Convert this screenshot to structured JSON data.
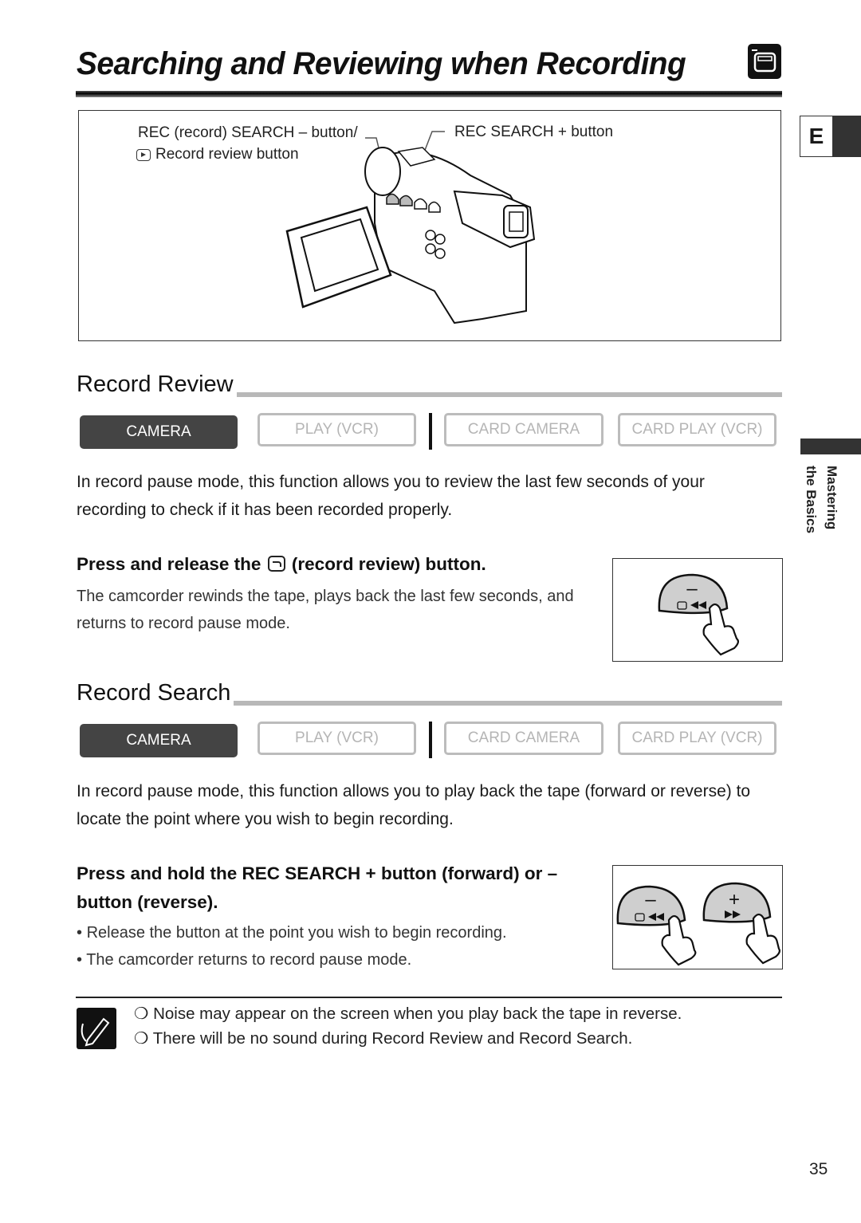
{
  "page": {
    "title": "Searching and Reviewing when Recording",
    "title_icon": "camera-mode-icon",
    "language_tab": "E",
    "side_section": {
      "line1": "Mastering",
      "line2": "the Basics"
    },
    "page_number": "35"
  },
  "illustration": {
    "label_minus_line1": "REC (record) SEARCH – button/",
    "label_minus_line2": "Record review button",
    "label_plus": "REC SEARCH + button",
    "icon": "camcorder-illustration"
  },
  "modes": [
    {
      "label": "CAMERA",
      "active": true
    },
    {
      "label": "PLAY (VCR)",
      "active": false
    },
    {
      "label": "CARD CAMERA",
      "active": false
    },
    {
      "label": "CARD PLAY (VCR)",
      "active": false
    }
  ],
  "record_review": {
    "heading": "Record Review",
    "intro": "In record pause mode, this function allows you to review the last few seconds of your recording to check if it has been recorded properly.",
    "step_prefix": "Press and release the",
    "step_suffix": "(record review) button.",
    "step_body": "The camcorder rewinds the tape, plays back the last few seconds, and returns to record pause mode.",
    "button_minus_symbol": "–"
  },
  "record_search": {
    "heading": "Record Search",
    "intro": "In record pause mode, this function allows you to play back the tape (forward or reverse) to locate the point where you wish to begin recording.",
    "step_head": "Press and hold the REC SEARCH + button (forward) or – button (reverse).",
    "bullets": [
      "Release the button at the point you wish to begin recording.",
      "The camcorder returns to record pause mode."
    ],
    "button_minus_symbol": "–",
    "button_plus_symbol": "+"
  },
  "notes": [
    "Noise may appear on the screen when you play back the tape in reverse.",
    "There will be no sound during Record Review and Record Search."
  ]
}
